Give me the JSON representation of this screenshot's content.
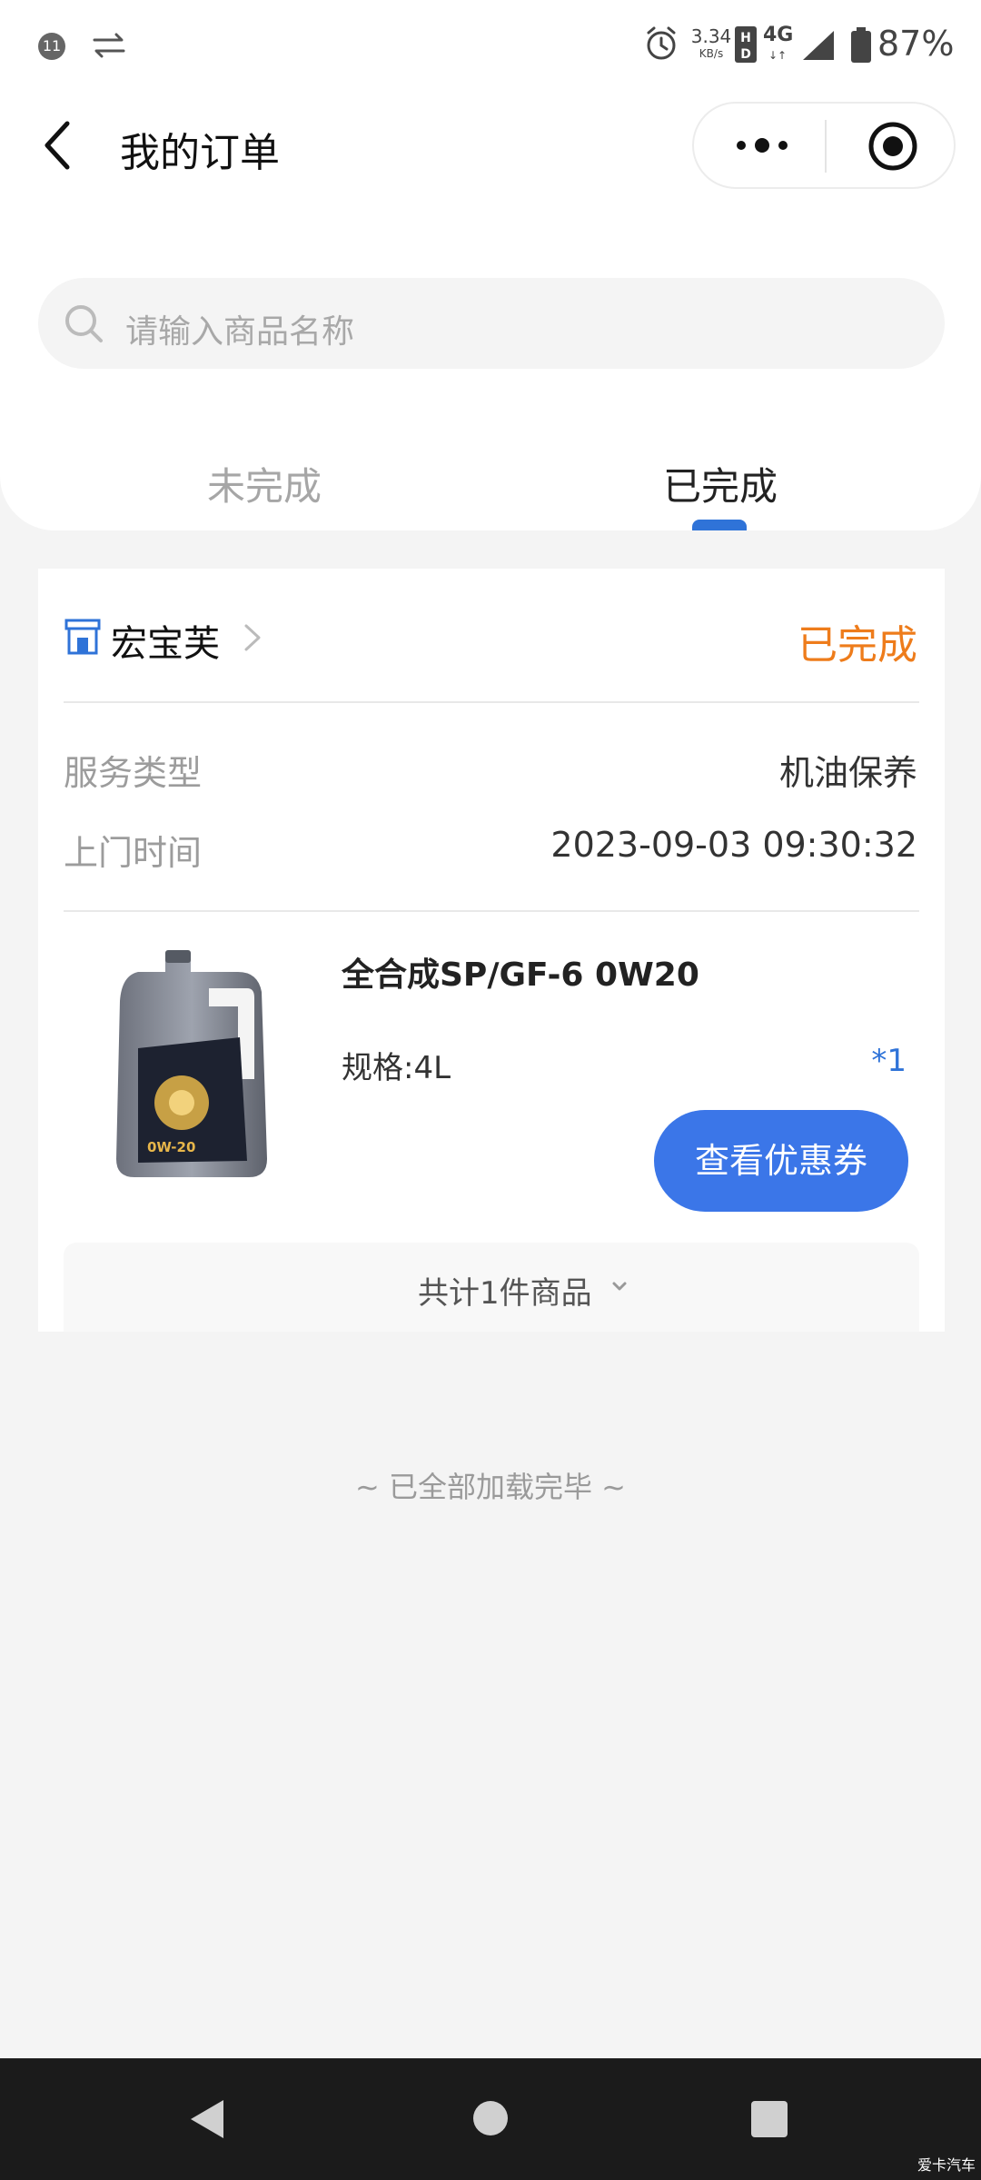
{
  "status_bar": {
    "notification_count": "11",
    "net_speed_value": "3.34",
    "net_speed_unit": "KB/s",
    "network_type": "4G",
    "network_arrows": "↓↑",
    "battery_percent": "87%",
    "icons": [
      "sync-icon",
      "alarm-icon",
      "hd-icon",
      "signal-icon",
      "battery-icon"
    ]
  },
  "header": {
    "title": "我的订单",
    "icons": [
      "back-icon",
      "more-icon",
      "close-icon"
    ]
  },
  "search": {
    "placeholder": "请输入商品名称"
  },
  "tabs": [
    {
      "label": "未完成",
      "selected": false
    },
    {
      "label": "已完成",
      "selected": true
    }
  ],
  "order": {
    "store_name": "宏宝芙",
    "status": "已完成",
    "fields": [
      {
        "label": "服务类型",
        "value": "机油保养"
      },
      {
        "label": "上门时间",
        "value": "2023-09-03 09:30:32"
      }
    ],
    "product": {
      "name": "全合成SP/GF-6 0W20",
      "spec": "规格:4L",
      "quantity": "*1",
      "image_label": "0W-20"
    },
    "coupon_button": "查看优惠券",
    "summary": "共计1件商品"
  },
  "footer": {
    "loaded_text": "~ 已全部加载完毕 ~"
  },
  "watermark": "爱卡汽车",
  "colors": {
    "accent_blue": "#3b76e8",
    "tab_indicator": "#2f73d8",
    "status_orange": "#ee7c1b",
    "background": "#f4f4f4"
  }
}
